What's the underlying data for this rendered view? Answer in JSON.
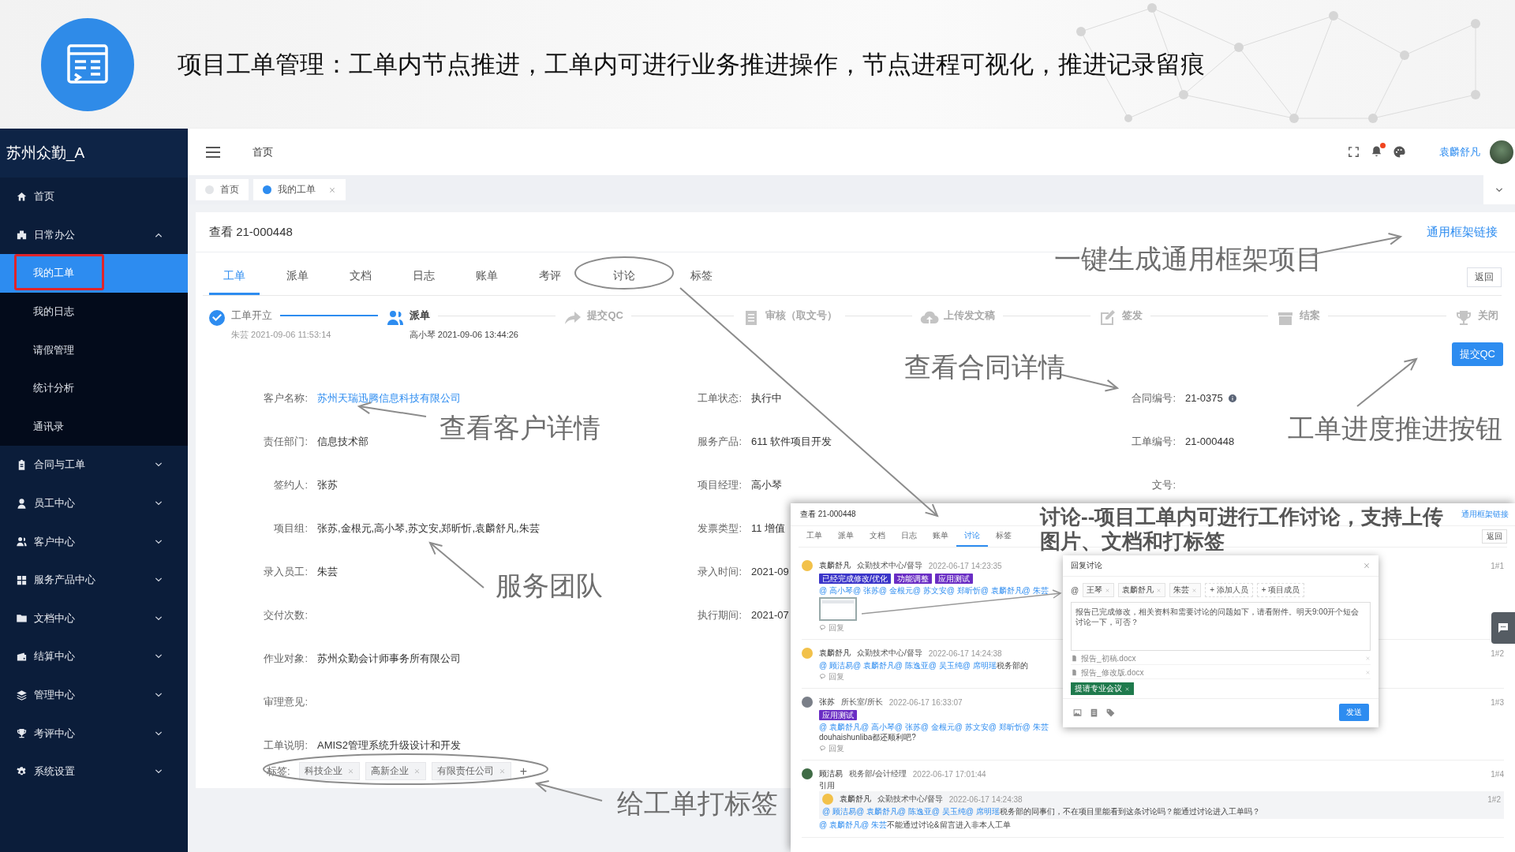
{
  "slide": {
    "title": "项目工单管理：工单内节点推进，工单内可进行业务推进操作，节点进程可视化，推进记录留痕"
  },
  "sidebar": {
    "brand": "苏州众勤_A",
    "items": [
      {
        "label": "首页",
        "selected": false
      },
      {
        "label": "日常办公",
        "selected": false,
        "expanded": true,
        "children": [
          {
            "label": "我的工单",
            "selected": true,
            "annotated": true
          },
          {
            "label": "我的日志",
            "selected": false,
            "annotated": false
          },
          {
            "label": "请假管理",
            "selected": false,
            "annotated": false
          },
          {
            "label": "统计分析",
            "selected": false,
            "annotated": false
          },
          {
            "label": "通讯录",
            "selected": false,
            "annotated": false
          }
        ]
      },
      {
        "label": "合同与工单",
        "selected": false,
        "expanded": false
      },
      {
        "label": "员工中心",
        "selected": false,
        "expanded": false
      },
      {
        "label": "客户中心",
        "selected": false,
        "expanded": false
      },
      {
        "label": "服务产品中心",
        "selected": false,
        "expanded": false
      },
      {
        "label": "文档中心",
        "selected": false,
        "expanded": false
      },
      {
        "label": "结算中心",
        "selected": false,
        "expanded": false
      },
      {
        "label": "管理中心",
        "selected": false,
        "expanded": false
      },
      {
        "label": "考评中心",
        "selected": false,
        "expanded": false
      },
      {
        "label": "系统设置",
        "selected": false,
        "expanded": false
      }
    ]
  },
  "topbar": {
    "breadcrumb": "首页",
    "notification": true,
    "user": "袁麟舒凡"
  },
  "page_tabs": [
    {
      "label": "首页",
      "selected": false,
      "closable": false
    },
    {
      "label": "我的工单",
      "selected": true,
      "closable": true
    }
  ],
  "work_order": {
    "title": "查看 21-000448",
    "link": "通用框架链接",
    "back": "返回",
    "tabs": [
      {
        "label": "工单",
        "selected": true
      },
      {
        "label": "派单",
        "selected": false
      },
      {
        "label": "文档",
        "selected": false
      },
      {
        "label": "日志",
        "selected": false
      },
      {
        "label": "账单",
        "selected": false
      },
      {
        "label": "考评",
        "selected": false
      },
      {
        "label": "讨论",
        "selected": false
      },
      {
        "label": "标签",
        "selected": false
      }
    ],
    "steps": [
      {
        "label": "工单开立",
        "done": true,
        "active": false,
        "meta": "朱芸 2021-09-06 11:53:14"
      },
      {
        "label": "派单",
        "done": false,
        "active": true,
        "meta": "高小琴 2021-09-06 13:44:26"
      },
      {
        "label": "提交QC",
        "done": false,
        "active": false
      },
      {
        "label": "审核（取文号）",
        "done": false,
        "active": false
      },
      {
        "label": "上传发文稿",
        "done": false,
        "active": false
      },
      {
        "label": "签发",
        "done": false,
        "active": false
      },
      {
        "label": "结案",
        "done": false,
        "active": false
      },
      {
        "label": "关闭",
        "done": false,
        "active": false
      }
    ],
    "submit": "提交QC",
    "field_columns": [
      {
        "fields": [
          {
            "label": "客户名称:",
            "value": "苏州天瑞迅腾信息科技有限公司",
            "kind": "link"
          },
          {
            "label": "责任部门:",
            "value": "信息技术部",
            "kind": "text"
          },
          {
            "label": "签约人:",
            "value": "张苏",
            "kind": "text"
          },
          {
            "label": "项目组:",
            "value": "张苏,金根元,高小琴,苏文安,郑昕忻,袁麟舒凡,朱芸",
            "kind": "text"
          },
          {
            "label": "录入员工:",
            "value": "朱芸",
            "kind": "text"
          },
          {
            "label": "交付次数:",
            "kind": "text"
          },
          {
            "label": "作业对象:",
            "value": "苏州众勤会计师事务所有限公司",
            "kind": "text"
          },
          {
            "label": "审理意见:",
            "kind": "text"
          },
          {
            "label": "工单说明:",
            "value": "AMIS2管理系统升级设计和开发",
            "kind": "text"
          }
        ]
      },
      {
        "fields": [
          {
            "label": "工单状态:",
            "value": "执行中",
            "kind": "text"
          },
          {
            "label": "服务产品:",
            "value": "611 软件项目开发",
            "kind": "text"
          },
          {
            "label": "项目经理:",
            "value": "高小琴",
            "kind": "text"
          },
          {
            "label": "发票类型:",
            "value": "11 增值",
            "kind": "text"
          },
          {
            "label": "录入时间:",
            "value": "2021-09",
            "kind": "text"
          },
          {
            "label": "执行期间:",
            "value": "2021-07",
            "kind": "text"
          }
        ]
      },
      {
        "fields": [
          {
            "label": "合同编号:",
            "value": "21-0375",
            "kind": "info"
          },
          {
            "label": "工单编号:",
            "value": "21-000448",
            "kind": "text"
          },
          {
            "label": "文号:",
            "kind": "text"
          }
        ]
      }
    ],
    "tags": {
      "label": "标签:",
      "items": [
        "科技企业",
        "高新企业",
        "有限责任公司"
      ],
      "add": "+"
    }
  },
  "annotations": [
    {
      "text": "一键生成通用框架项目"
    },
    {
      "text": "查看合同详情"
    },
    {
      "text": "查看客户详情"
    },
    {
      "text": "工单进度推进按钮"
    },
    {
      "text": "服务团队"
    },
    {
      "text": "给工单打标签"
    }
  ],
  "discussion": {
    "title": "查看 21-000448",
    "link": "通用框架链接",
    "back": "返回",
    "caption": "讨论--项目工单内可进行工作讨论，支持上传图片、文档和打标签",
    "tabs": [
      {
        "label": "工单",
        "selected": false
      },
      {
        "label": "派单",
        "selected": false
      },
      {
        "label": "文档",
        "selected": false
      },
      {
        "label": "日志",
        "selected": false
      },
      {
        "label": "账单",
        "selected": false
      },
      {
        "label": "讨论",
        "selected": true
      },
      {
        "label": "标签",
        "selected": false
      }
    ],
    "comments": [
      {
        "author": "袁麟舒凡",
        "role": "众勤技术中心/督导",
        "time": "2022-06-17 14:23:35",
        "floor": "1#1",
        "tags": [
          {
            "text": "已经完成修改/优化",
            "color": "#3b35c9"
          },
          {
            "text": "功能调整",
            "color": "#6a2dc4"
          },
          {
            "text": "应用测试",
            "color": "#6a2dc4"
          }
        ],
        "mentions": "@ 高小琴@ 张苏@ 金根元@ 苏文安@ 郑昕忻@ 袁麟舒凡@ 朱芸",
        "attachment": true,
        "reply": "回复"
      },
      {
        "author": "袁麟舒凡",
        "role": "众勤技术中心/督导",
        "time": "2022-06-17 14:24:38",
        "floor": "1#2",
        "mentions": "@ 顾洁易@ 袁麟舒凡@ 陈逸亚@ 吴玉纯@ 席明瑶",
        "text": "税务部的",
        "reply": "回复"
      },
      {
        "author": "张苏",
        "role": "所长室/所长",
        "time": "2022-06-17 16:33:07",
        "floor": "1#3",
        "tags": [
          {
            "text": "应用测试",
            "color": "#6a2dc4"
          }
        ],
        "mentions": "@ 袁麟舒凡@ 高小琴@ 张苏@ 金根元@ 苏文安@ 郑昕忻@ 朱芸",
        "text": "douhaishunliba都还顺利吧?",
        "reply": "回复"
      },
      {
        "author": "顾洁易",
        "role": "税务部/会计经理",
        "time": "2022-06-17 17:01:44",
        "floor": "1#4",
        "quote_label": "引用",
        "quote": {
          "author": "袁麟舒凡",
          "role": "众勤技术中心/督导",
          "time": "2022-06-17 14:24:38",
          "floor": "1#2",
          "mentions": "@ 顾洁易@ 袁麟舒凡@ 陈逸亚@ 吴玉纯@ 席明瑶",
          "text": "税务部的同事们，不在项目里能看到这条讨论吗？能通过讨论进入工单吗？"
        },
        "mentions": "@ 袁麟舒凡@ 朱芸",
        "text": "不能通过讨论&留言进入非本人工单"
      }
    ],
    "dialog": {
      "title": "回复讨论",
      "at": "@",
      "people": [
        "王琴",
        "袁麟舒凡",
        "朱芸"
      ],
      "actions": [
        "+ 添加人员",
        "+ 项目成员"
      ],
      "message": "报告已完成修改，相关资料和需要讨论的问题如下，请看附件。明天9:00开个短会讨论一下，可否？",
      "files": [
        "报告_初稿.docx",
        "报告_修改版.docx"
      ],
      "tags": [
        {
          "text": "提请专业会议",
          "color": "#1f7a4d"
        }
      ],
      "send": "发送"
    }
  }
}
